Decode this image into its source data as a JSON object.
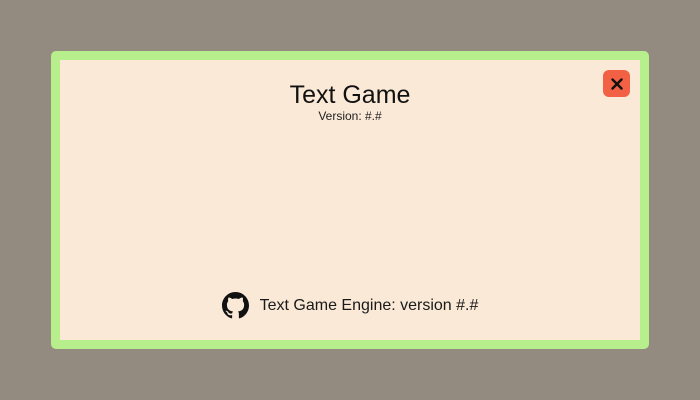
{
  "dialog": {
    "title": "Text Game",
    "version_label": "Version: #.#",
    "close_icon": "close-icon",
    "footer": {
      "github_icon": "github-icon",
      "engine_text": "Text Game Engine: version #.#"
    }
  },
  "colors": {
    "backdrop": "#948b80",
    "frame": "#b6ef8c",
    "panel": "#fae9d6",
    "close_button": "#f36144"
  }
}
